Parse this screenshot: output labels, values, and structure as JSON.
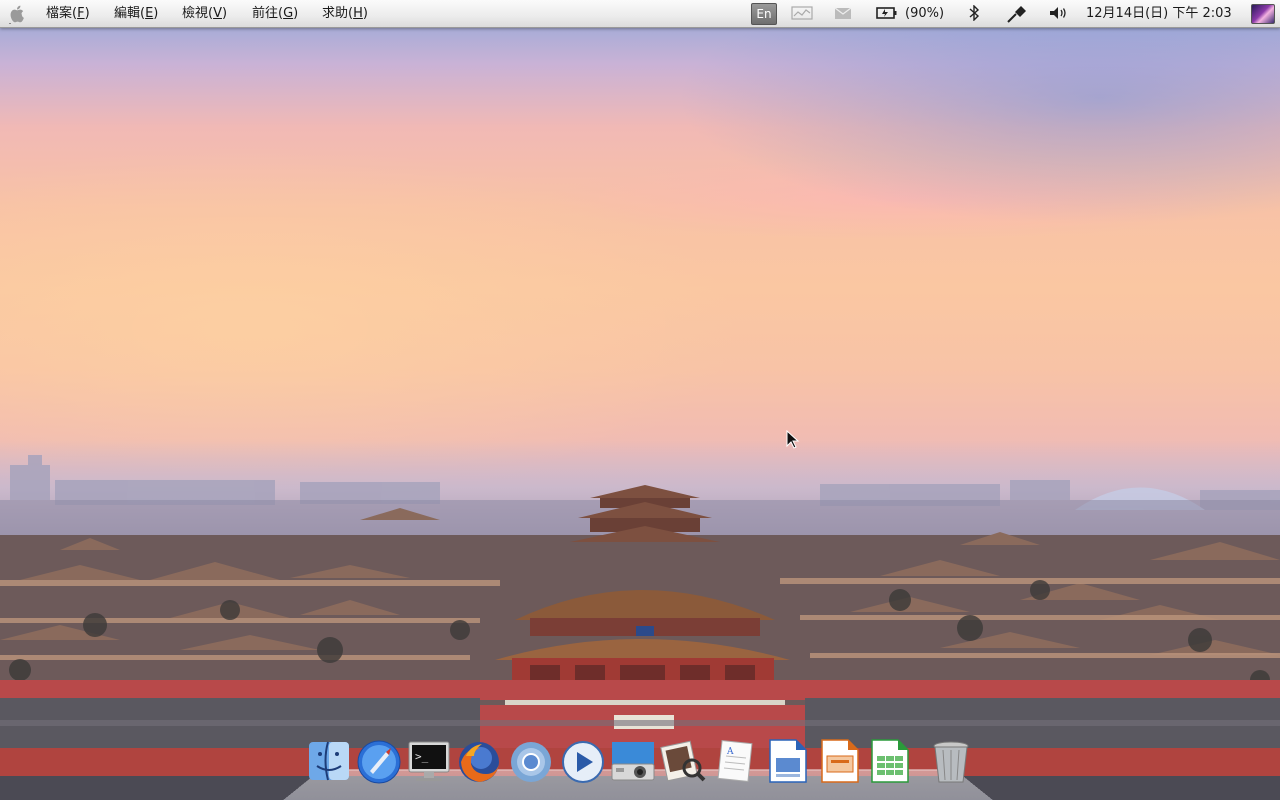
{
  "menubar": {
    "apple_icon": "apple-logo-icon",
    "menus": [
      {
        "label_main": "檔案(",
        "label_key": "F",
        "label_end": ")"
      },
      {
        "label_main": "編輯(",
        "label_key": "E",
        "label_end": ")"
      },
      {
        "label_main": "檢視(",
        "label_key": "V",
        "label_end": ")"
      },
      {
        "label_main": "前往(",
        "label_key": "G",
        "label_end": ")"
      },
      {
        "label_main": "求助(",
        "label_key": "H",
        "label_end": ")"
      }
    ],
    "indicators": {
      "input_method": "En",
      "battery_text": "(90%)",
      "clock": "12月14日(日) 下午 2:03"
    }
  },
  "dock": {
    "items": [
      "finder-icon",
      "launchpad-rocket-icon",
      "terminal-icon",
      "firefox-icon",
      "chromium-icon",
      "media-player-icon",
      "photo-booth-icon",
      "preview-icon",
      "text-editor-icon",
      "writer-icon",
      "impress-icon",
      "calc-icon",
      "trash-icon"
    ]
  },
  "colors": {
    "menubar_bg": "#ececec",
    "sky_top": "#8fa8d8",
    "sky_mid": "#fac7a2",
    "roof_color": "#8a5a3e",
    "wall_red": "#b8494a"
  }
}
